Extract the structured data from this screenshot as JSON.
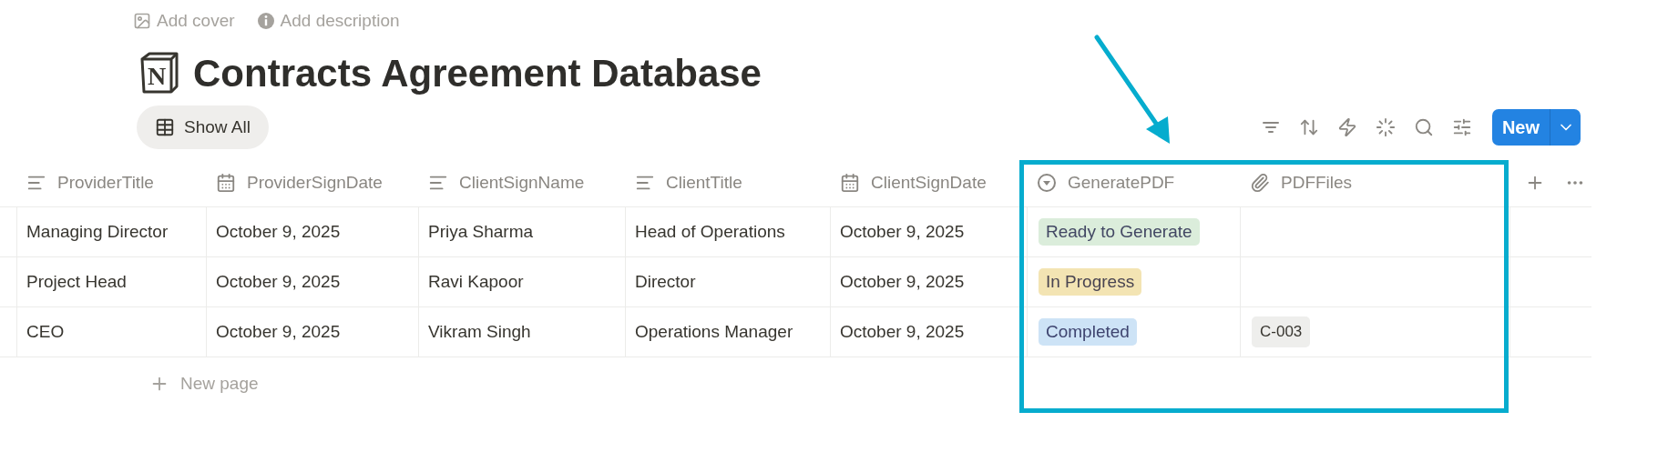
{
  "page_actions": [
    {
      "label": "Add cover",
      "kind": "cover"
    },
    {
      "label": "Add description",
      "kind": "description"
    }
  ],
  "title": {
    "icon_letter": "N",
    "text": "Contracts Agreement Database"
  },
  "view_tab": {
    "label": "Show All"
  },
  "new_button": {
    "label": "New"
  },
  "table": {
    "columns": [
      {
        "name": "ProviderTitle",
        "kind": "text"
      },
      {
        "name": "ProviderSignDate",
        "kind": "date"
      },
      {
        "name": "ClientSignName",
        "kind": "text"
      },
      {
        "name": "ClientTitle",
        "kind": "text"
      },
      {
        "name": "ClientSignDate",
        "kind": "date"
      },
      {
        "name": "GeneratePDF",
        "kind": "status"
      },
      {
        "name": "PDFFiles",
        "kind": "files"
      }
    ],
    "rows": [
      {
        "cells": [
          "Managing Director",
          "October 9, 2025",
          "Priya Sharma",
          "Head of Operations",
          "October 9, 2025"
        ],
        "status": {
          "label": "Ready to Generate",
          "color": "#dbeddb"
        }
      },
      {
        "cells": [
          "Project Head",
          "October 9, 2025",
          "Ravi Kapoor",
          "Director",
          "October 9, 2025"
        ],
        "status": {
          "label": "In Progress",
          "color": "#f3e4b3"
        }
      },
      {
        "cells": [
          "CEO",
          "October 9, 2025",
          "Vikram Singh",
          "Operations Manager",
          "October 9, 2025"
        ],
        "status": {
          "label": "Completed",
          "color": "#cde3f6"
        },
        "files": [
          "C-003"
        ]
      }
    ],
    "new_row": "New page"
  }
}
